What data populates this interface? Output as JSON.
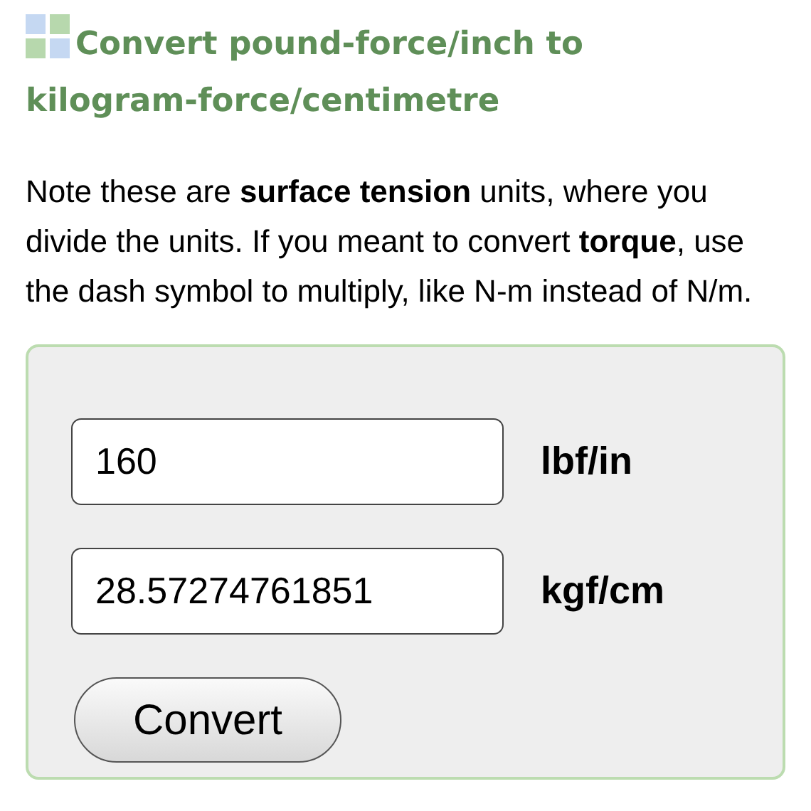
{
  "heading_lines": [
    "Convert pound-force/inch to",
    "kilogram-force/centimetre"
  ],
  "note": "Note these are **surface tension** units, where you divide the units. If you meant to convert **torque**, use the dash symbol to multiply, like N-m instead of N/m.",
  "converter": {
    "fields": [
      {
        "value": "160",
        "unit": "lbf/in"
      },
      {
        "value": "28.57274761851",
        "unit": "kgf/cm"
      }
    ],
    "button": "Convert"
  }
}
